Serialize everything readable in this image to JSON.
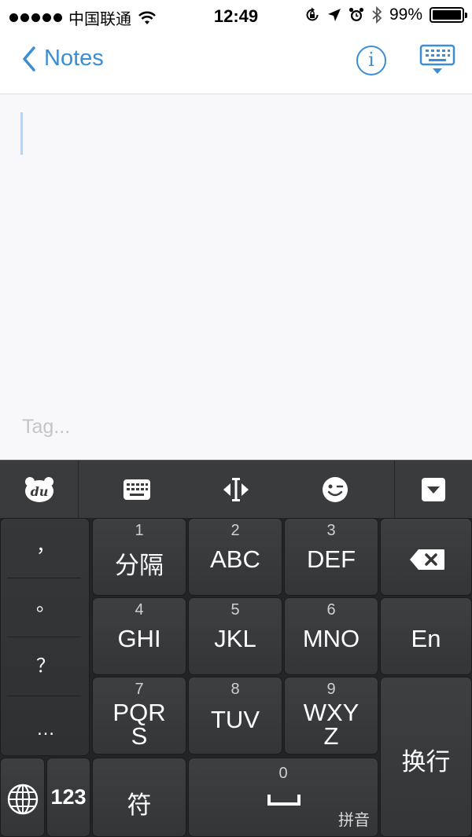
{
  "status_bar": {
    "carrier": "中国联通",
    "time": "12:49",
    "battery_percent": "99%",
    "battery_level": 0.99,
    "icons": [
      "signal-dots",
      "wifi-icon",
      "rotation-lock-icon",
      "location-arrow-icon",
      "alarm-icon",
      "bluetooth-icon",
      "battery-icon"
    ]
  },
  "nav": {
    "back_label": "Notes",
    "info_label": "i",
    "accent_color": "#3a8ed6"
  },
  "editor": {
    "tag_placeholder": "Tag..."
  },
  "keyboard": {
    "toolbar": {
      "logo_text": "du",
      "icons": [
        "keyboard-icon",
        "cursor-move-icon",
        "emoji-icon",
        "dropdown-icon"
      ]
    },
    "side_keys": [
      "，",
      "。",
      "？",
      "…"
    ],
    "keys": {
      "k1": {
        "num": "1",
        "label": "分隔"
      },
      "k2": {
        "num": "2",
        "label": "ABC"
      },
      "k3": {
        "num": "3",
        "label": "DEF"
      },
      "k4": {
        "num": "4",
        "label": "GHI"
      },
      "k5": {
        "num": "5",
        "label": "JKL"
      },
      "k6": {
        "num": "6",
        "label": "MNO"
      },
      "k7": {
        "num": "7",
        "label_line1": "PQR",
        "label_line2": "S"
      },
      "k8": {
        "num": "8",
        "label": "TUV"
      },
      "k9": {
        "num": "9",
        "label_line1": "WXY",
        "label_line2": "Z"
      },
      "en": "En",
      "newline": "换行",
      "num_mode": "123",
      "symbols": "符",
      "space_num": "0",
      "input_mode": "拼音"
    }
  }
}
